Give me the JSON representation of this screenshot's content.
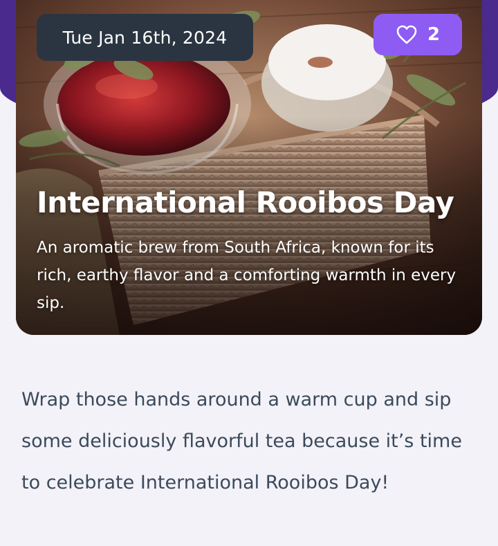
{
  "hero": {
    "date": "Tue Jan 16th, 2024",
    "likes": {
      "count": "2",
      "icon": "heart-outline-icon"
    },
    "title": "International Rooibos Day",
    "subtitle": "An aromatic brew from South Africa, known for its rich, earthy flavor and a comforting warmth in every sip."
  },
  "article": {
    "intro": "Wrap those hands around a warm cup and sip some deliciously flavorful tea because it’s time to celebrate International Rooibos Day!"
  },
  "colors": {
    "header_bg": "#4a2a8c",
    "date_pill": "#2b3541",
    "like_pill": "#8e5cf2",
    "page_bg": "#f3f2f8",
    "body_text": "#3b4a5a"
  }
}
